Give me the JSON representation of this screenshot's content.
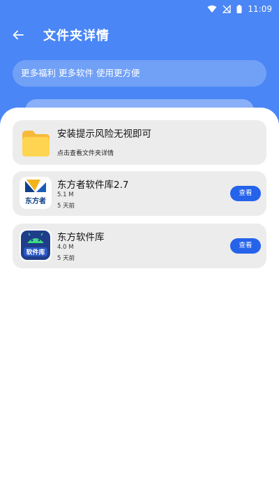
{
  "status": {
    "time": "11:09"
  },
  "header": {
    "title": "文件夹详情"
  },
  "banner": {
    "text": "更多福利 更多软件 使用更方便"
  },
  "folder_card": {
    "title": "安装提示风险无视即可",
    "subtitle": "点击查看文件夹详情"
  },
  "apps": [
    {
      "name": "东方者软件库2.7",
      "size": "5.1 M",
      "age": "5 天前",
      "button": "查看",
      "icon_text": "东方者",
      "icon": "dongfangzhe-logo-icon"
    },
    {
      "name": "东方软件库",
      "size": "4.0 M",
      "age": "5 天前",
      "button": "查看",
      "icon_text": "软件库",
      "icon": "android-software-icon"
    }
  ],
  "colors": {
    "header_bg": "#4a86f5",
    "button": "#2563eb",
    "card_bg": "#ececec",
    "folder": "#ffd451"
  }
}
